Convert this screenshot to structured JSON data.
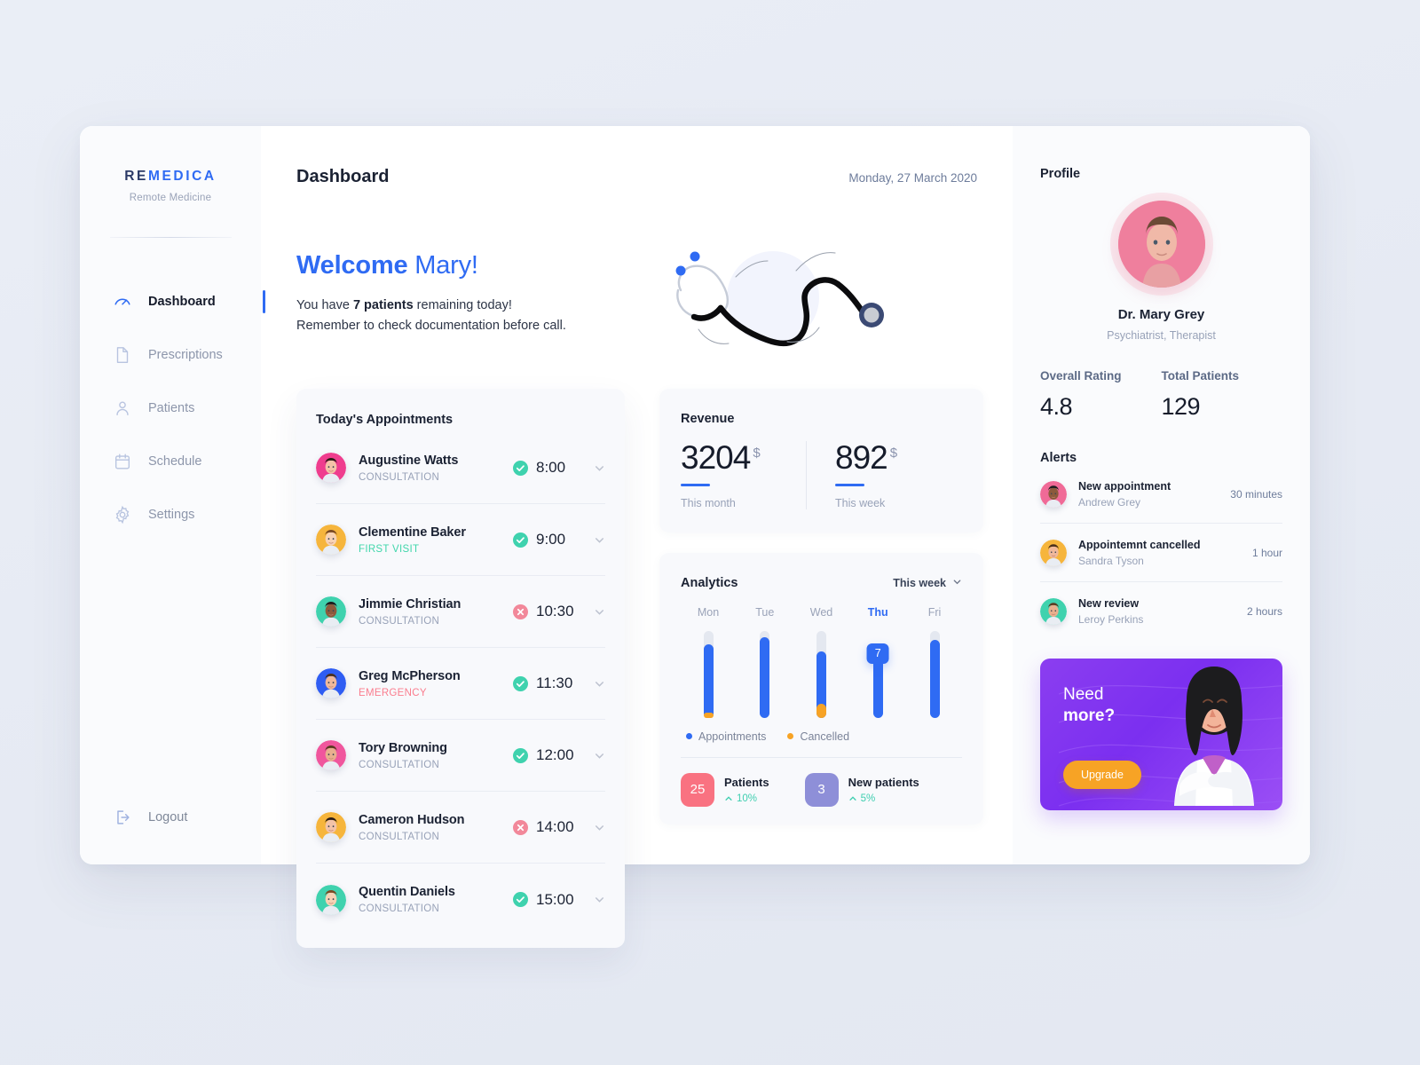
{
  "brand": {
    "logo_prefix": "RE",
    "logo_accent": "MEDICA",
    "tagline": "Remote Medicine",
    "accent_color": "#2f6bf3",
    "navy_color": "#2b3a67"
  },
  "sidebar": {
    "items": [
      {
        "label": "Dashboard",
        "icon": "gauge-icon",
        "active": true
      },
      {
        "label": "Prescriptions",
        "icon": "document-icon",
        "active": false
      },
      {
        "label": "Patients",
        "icon": "person-icon",
        "active": false
      },
      {
        "label": "Schedule",
        "icon": "calendar-icon",
        "active": false
      },
      {
        "label": "Settings",
        "icon": "gear-icon",
        "active": false
      }
    ],
    "logout": {
      "label": "Logout",
      "icon": "logout-icon"
    }
  },
  "header": {
    "title": "Dashboard",
    "date": "Monday, 27 March 2020"
  },
  "hero": {
    "welcome_bold": "Welcome",
    "welcome_name": "Mary!",
    "line1_pre": "You have ",
    "line1_bold": "7 patients",
    "line1_post": " remaining today!",
    "line2": "Remember to check documentation before call.",
    "illustration": "stethoscope-illustration"
  },
  "appointments": {
    "title": "Today's Appointments",
    "items": [
      {
        "name": "Augustine Watts",
        "type": "CONSULTATION",
        "type_style": "default",
        "time": "8:00",
        "status": "confirmed",
        "avatar_bg": "#ef3d8e"
      },
      {
        "name": "Clementine Baker",
        "type": "FIRST VISIT",
        "type_style": "first",
        "time": "9:00",
        "status": "confirmed",
        "avatar_bg": "#f6b53c"
      },
      {
        "name": "Jimmie Christian",
        "type": "CONSULTATION",
        "type_style": "default",
        "time": "10:30",
        "status": "cancelled",
        "avatar_bg": "#3fd2ae"
      },
      {
        "name": "Greg McPherson",
        "type": "EMERGENCY",
        "type_style": "emerg",
        "time": "11:30",
        "status": "confirmed",
        "avatar_bg": "#2f5df3"
      },
      {
        "name": "Tory Browning",
        "type": "CONSULTATION",
        "type_style": "default",
        "time": "12:00",
        "status": "confirmed",
        "avatar_bg": "#f0569d"
      },
      {
        "name": "Cameron Hudson",
        "type": "CONSULTATION",
        "type_style": "default",
        "time": "14:00",
        "status": "cancelled",
        "avatar_bg": "#f6b53c"
      },
      {
        "name": "Quentin Daniels",
        "type": "CONSULTATION",
        "type_style": "default",
        "time": "15:00",
        "status": "confirmed",
        "avatar_bg": "#3fd2ae"
      }
    ]
  },
  "revenue": {
    "title": "Revenue",
    "cells": [
      {
        "value": "3204",
        "currency": "$",
        "label": "This month"
      },
      {
        "value": "892",
        "currency": "$",
        "label": "This week"
      }
    ]
  },
  "analytics": {
    "title": "Analytics",
    "range": "This week",
    "legend": [
      {
        "label": "Appointments",
        "color": "#2f6bf3"
      },
      {
        "label": "Cancelled",
        "color": "#f7a325"
      }
    ],
    "stats": [
      {
        "count": "25",
        "name": "Patients",
        "delta": "10%",
        "badge_color": "#f97281"
      },
      {
        "count": "3",
        "name": "New patients",
        "delta": "5%",
        "badge_color": "#8e8fd8"
      }
    ]
  },
  "chart_data": {
    "type": "bar",
    "title": "Analytics",
    "xlabel": "",
    "ylabel": "",
    "grid": false,
    "legend_position": "bottom-left",
    "categories": [
      "Mon",
      "Tue",
      "Wed",
      "Thu",
      "Fri"
    ],
    "highlighted_category": "Thu",
    "tooltip": {
      "category": "Thu",
      "value": "7"
    },
    "ylim": [
      0,
      10
    ],
    "series": [
      {
        "name": "Appointments",
        "color": "#2f6bf3",
        "values": [
          8.4,
          9.2,
          7.6,
          7.0,
          8.9
        ]
      },
      {
        "name": "Cancelled",
        "color": "#f7a325",
        "values": [
          0.6,
          0.0,
          1.6,
          0.0,
          0.0
        ]
      }
    ],
    "track_max": 10
  },
  "profile": {
    "section_title": "Profile",
    "name": "Dr. Mary Grey",
    "role": "Psychiatrist, Therapist",
    "avatar_bg": "#ef7f9d",
    "kpis": [
      {
        "label": "Overall Rating",
        "value": "4.8"
      },
      {
        "label": "Total Patients",
        "value": "129"
      }
    ]
  },
  "alerts": {
    "title": "Alerts",
    "items": [
      {
        "title": "New appointment",
        "person": "Andrew Grey",
        "time": "30 minutes",
        "avatar_bg": "#f06a97"
      },
      {
        "title": "Appointemnt cancelled",
        "person": "Sandra Tyson",
        "time": "1 hour",
        "avatar_bg": "#f6b53c"
      },
      {
        "title": "New review",
        "person": "Leroy Perkins",
        "time": "2 hours",
        "avatar_bg": "#3fd2ae"
      }
    ]
  },
  "promo": {
    "line1": "Need",
    "line2": "more?",
    "button": "Upgrade",
    "bg_color": "#7b2ff0",
    "button_color": "#f7a325",
    "illustration": "doctor-illustration"
  }
}
